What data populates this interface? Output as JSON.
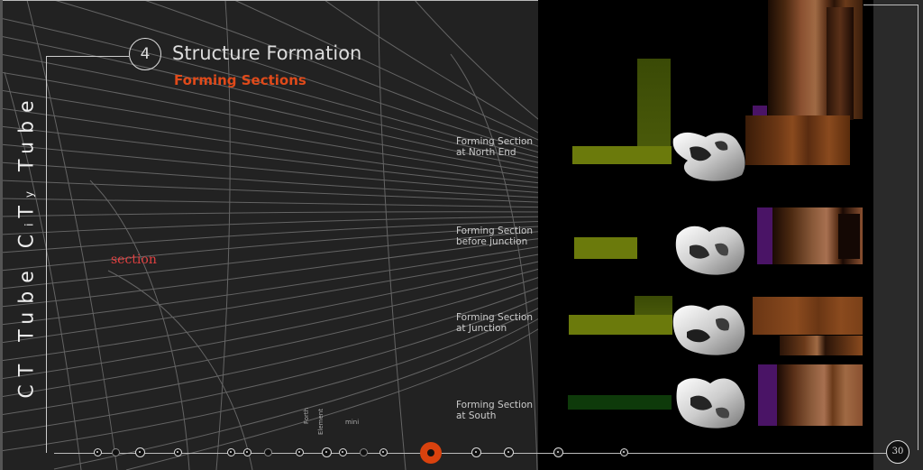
{
  "side_title": {
    "part1": "CT Tube ",
    "part2": "C",
    "sub1": "i",
    "part3": "T",
    "sub2": "y",
    "part4": " Tube"
  },
  "header": {
    "step_number": "4",
    "title": "Structure Formation",
    "subtitle": "Forming Sections"
  },
  "canvas": {
    "section_label": "section"
  },
  "sections": [
    {
      "line1": "Forming Section",
      "line2": "at North End"
    },
    {
      "line1": "Forming Section",
      "line2": "before junction"
    },
    {
      "line1": "Forming Section",
      "line2": "at Junction"
    },
    {
      "line1": "Forming Section",
      "line2": "at South"
    }
  ],
  "timeline": {
    "small_labels": [
      "Forth",
      "Element",
      "mini"
    ]
  },
  "page_number": "30",
  "colors": {
    "accent": "#d9420e",
    "subtitle": "#e04a1a",
    "section_label": "#e04040",
    "olive": "#6b7a0c",
    "copper": "#8a4a1e",
    "purple": "#4a1466"
  }
}
